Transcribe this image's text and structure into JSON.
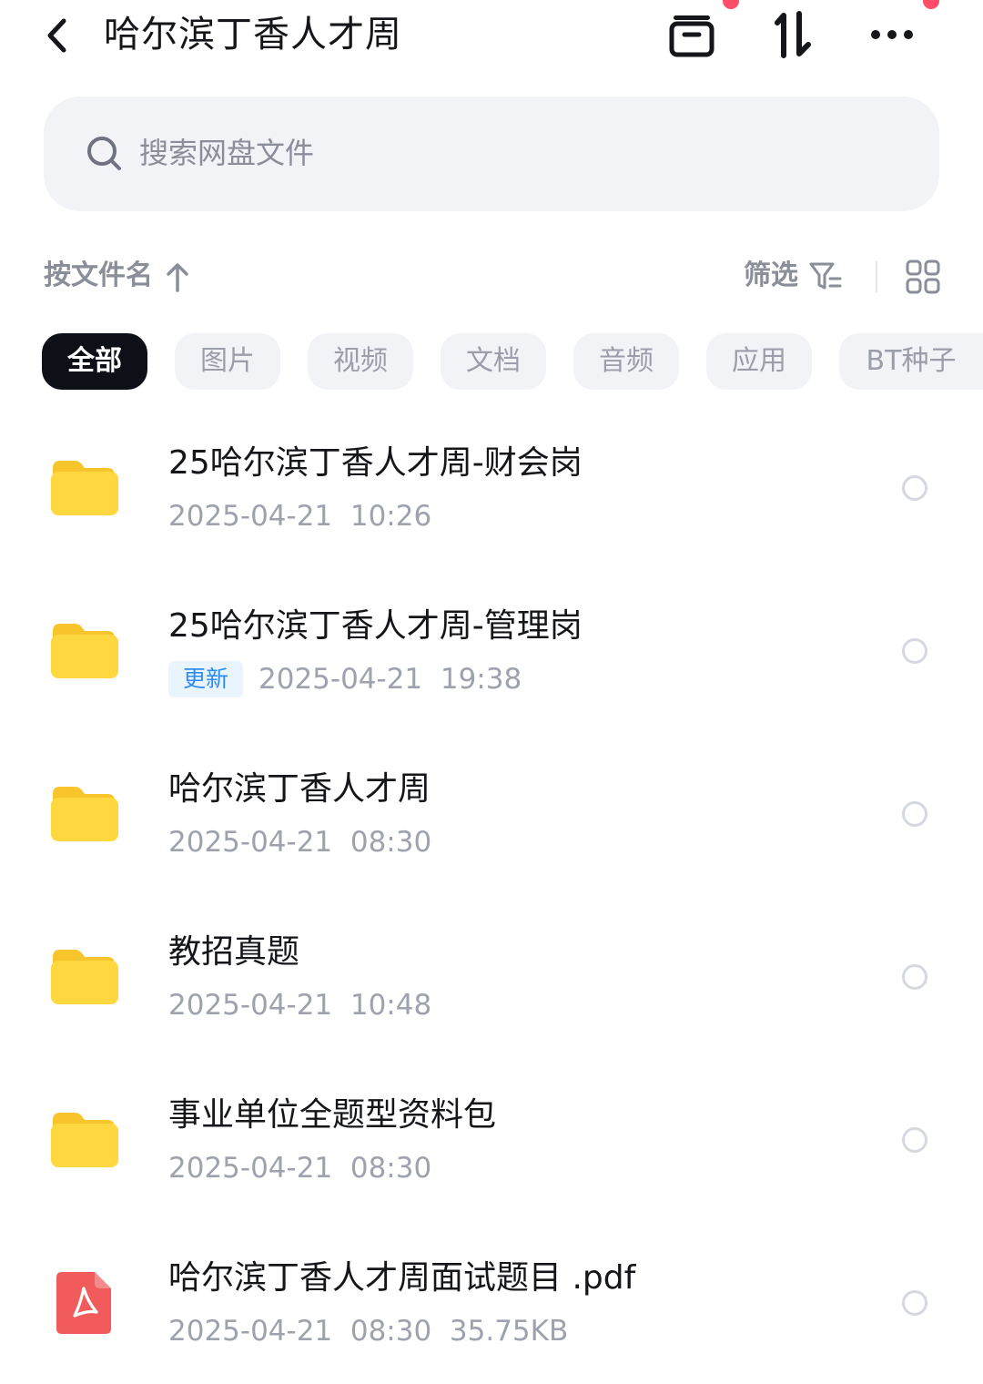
{
  "header": {
    "title": "哈尔滨丁香人才周",
    "back_icon": "chevron-left-icon",
    "actions": [
      "archive-box-icon",
      "sort-transfer-icon",
      "more-dots-icon"
    ],
    "badge_color": "#ff4d6a"
  },
  "search": {
    "placeholder": "搜索网盘文件"
  },
  "toolbar": {
    "sort_label": "按文件名",
    "filter_label": "筛选"
  },
  "categories": [
    "全部",
    "图片",
    "视频",
    "文档",
    "音频",
    "应用",
    "BT种子"
  ],
  "active_category": "全部",
  "files": [
    {
      "type": "folder",
      "name": "25哈尔滨丁香人才周-财会岗",
      "meta": "2025-04-21  10:26",
      "badge": ""
    },
    {
      "type": "folder",
      "name": "25哈尔滨丁香人才周-管理岗",
      "meta": "2025-04-21  19:38",
      "badge": "更新"
    },
    {
      "type": "folder",
      "name": "哈尔滨丁香人才周",
      "meta": "2025-04-21  08:30",
      "badge": ""
    },
    {
      "type": "folder",
      "name": "教招真题",
      "meta": "2025-04-21  10:48",
      "badge": ""
    },
    {
      "type": "folder",
      "name": "事业单位全题型资料包",
      "meta": "2025-04-21  08:30",
      "badge": ""
    },
    {
      "type": "pdf",
      "name": "哈尔滨丁香人才周面试题目 .pdf",
      "meta": "2025-04-21  08:30  35.75KB",
      "badge": ""
    }
  ],
  "colors": {
    "folder": "#ffd23f",
    "pdf": "#f25b5b",
    "accent": "#2d8cf0",
    "active_chip": "#0d1117"
  }
}
